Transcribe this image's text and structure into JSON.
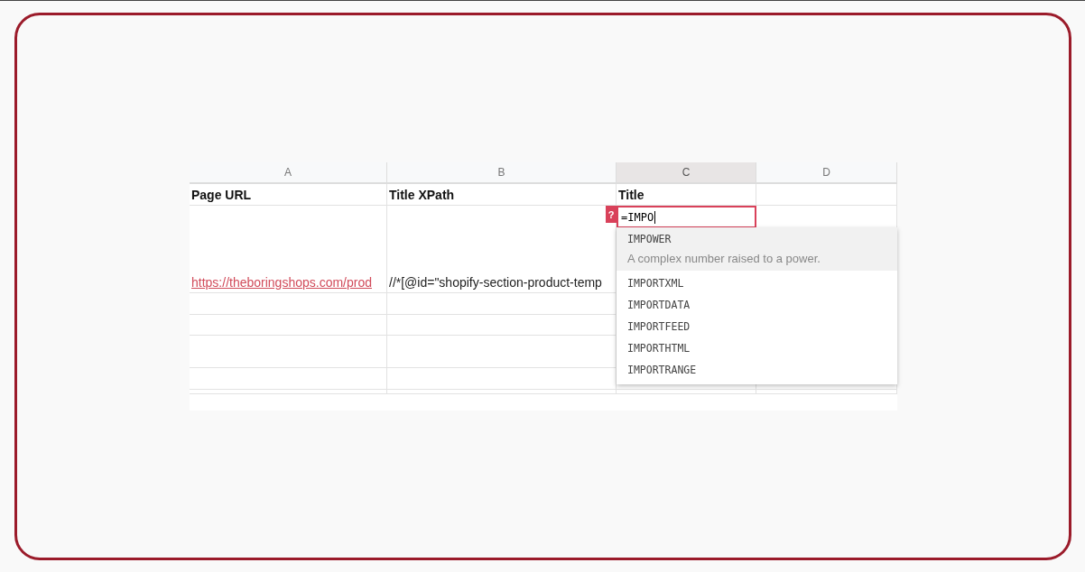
{
  "columns": [
    {
      "label": "A",
      "selected": false
    },
    {
      "label": "B",
      "selected": false
    },
    {
      "label": "C",
      "selected": true
    },
    {
      "label": "D",
      "selected": false
    }
  ],
  "header_row": [
    "Page URL",
    "Title XPath",
    "Title"
  ],
  "data_row": {
    "url": "https://theboringshops.com/prod",
    "xpath": "//*[@id=\"shopify-section-product-temp"
  },
  "editor": {
    "value": "=IMPO",
    "badge": "?"
  },
  "suggestions": [
    {
      "name": "IMPOWER",
      "description": "A complex number raised to a power.",
      "selected": true
    },
    {
      "name": "IMPORTXML",
      "selected": false
    },
    {
      "name": "IMPORTDATA",
      "selected": false
    },
    {
      "name": "IMPORTFEED",
      "selected": false
    },
    {
      "name": "IMPORTHTML",
      "selected": false
    },
    {
      "name": "IMPORTRANGE",
      "selected": false
    }
  ]
}
